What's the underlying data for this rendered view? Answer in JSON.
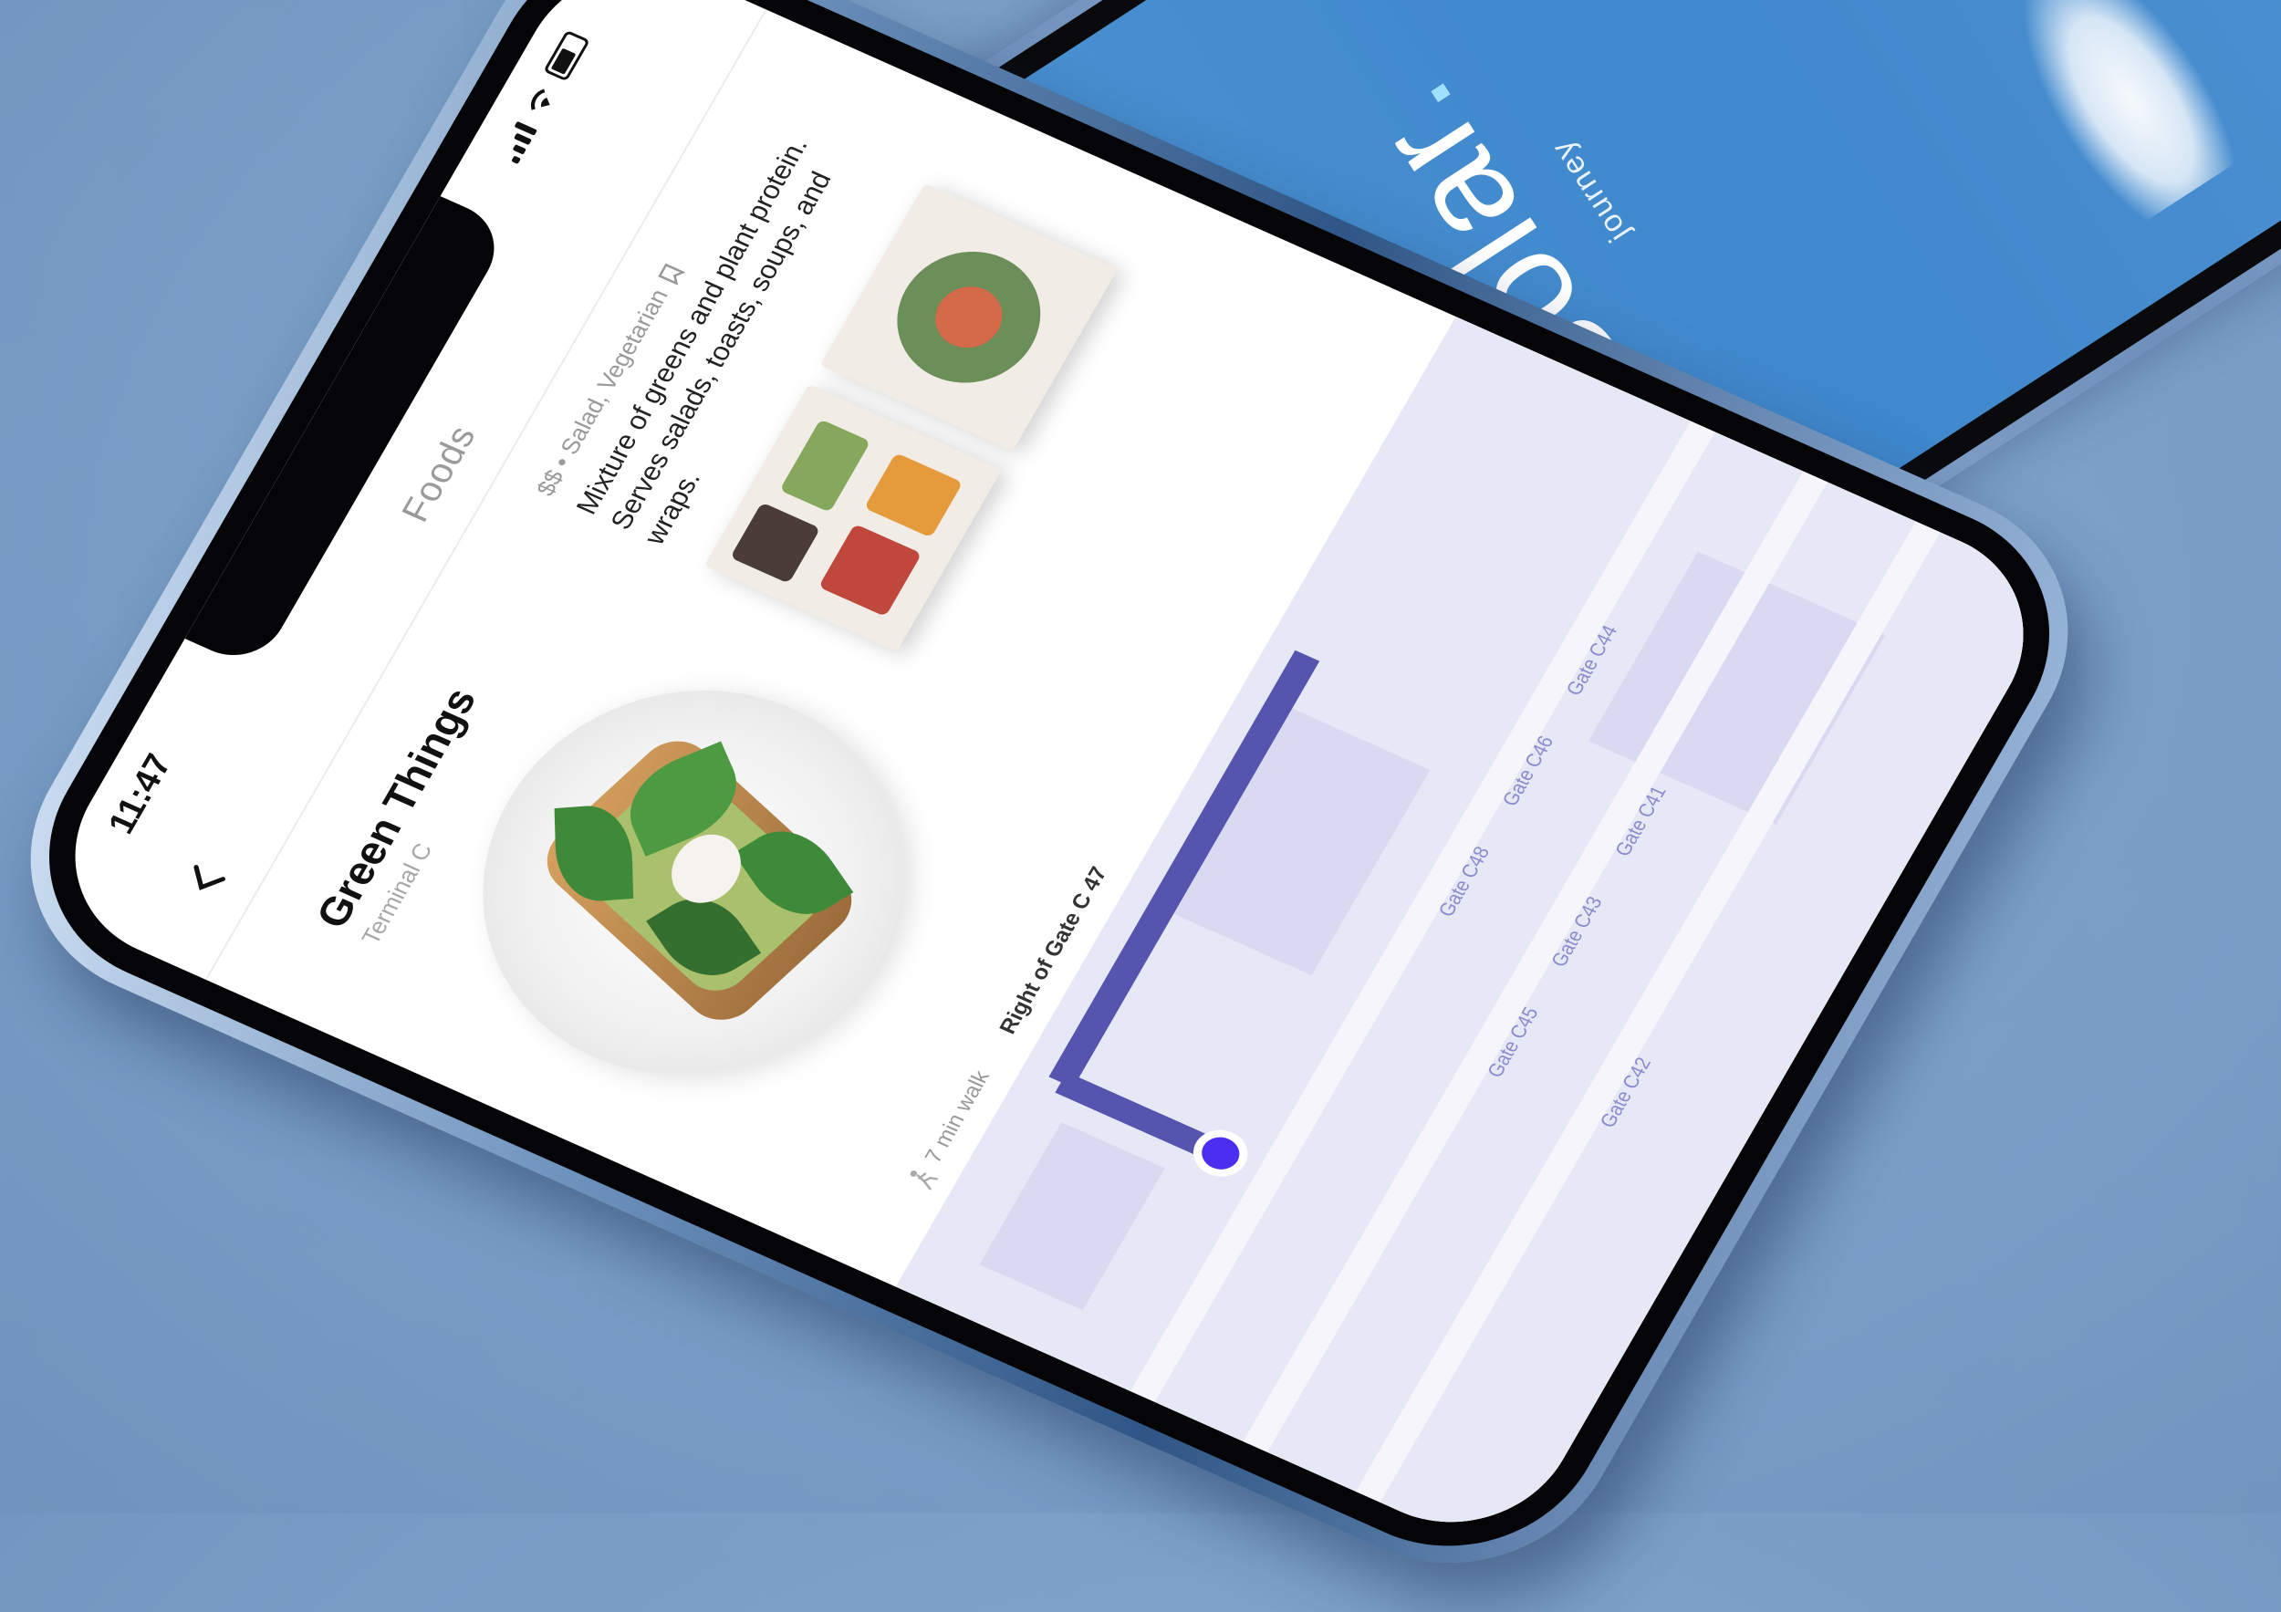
{
  "back_phone": {
    "brand": "Solar",
    "brand_dot": ".",
    "tagline": "journey"
  },
  "status_bar": {
    "time": "11:47"
  },
  "nav": {
    "title": "Foods",
    "back_icon": "chevron-left-icon"
  },
  "place": {
    "title": "Green Things",
    "subtitle": "Terminal C",
    "meta": "$$ • Salad, Vegetarian",
    "meta_icon": "bookmark-icon",
    "description": "Mixture of greens and plant protein. Serves salads, toasts, soups, and wraps."
  },
  "route": {
    "walk_time": "7 min walk",
    "walk_icon": "walking-person-icon",
    "location": "Right of Gate C 47"
  },
  "map": {
    "gate_labels": [
      "Gate C48",
      "Gate C46",
      "Gate C44",
      "Gate C45",
      "Gate C43",
      "Gate C41",
      "Gate C42"
    ],
    "route_color": "#5555b0",
    "pin_color": "#4b2ff0"
  },
  "colors": {
    "background": "#7a9ec6",
    "back_screen": "#4a8fd0",
    "map_bg": "#e7e8f6",
    "map_block": "#d9daf2"
  }
}
